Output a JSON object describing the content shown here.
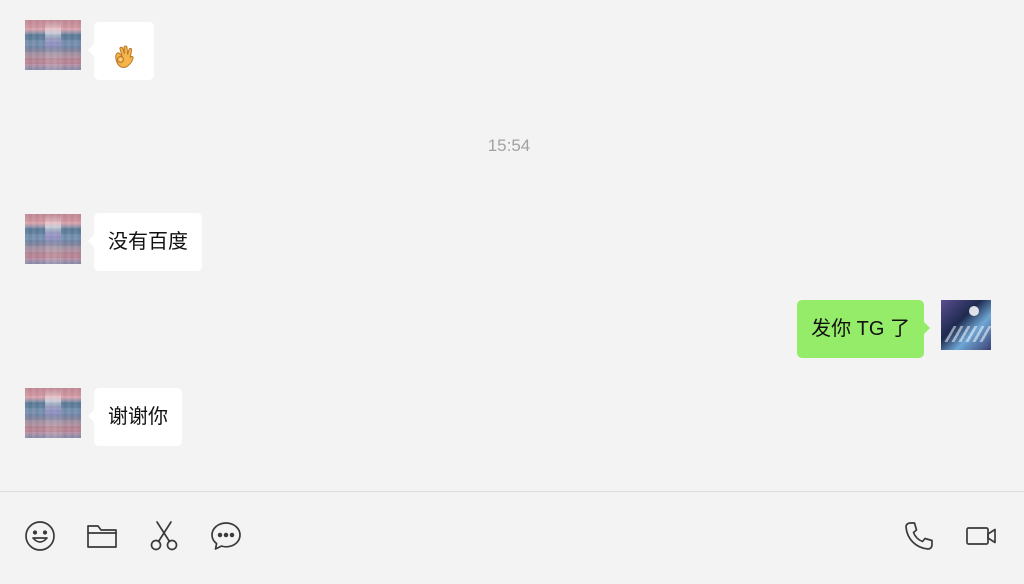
{
  "chat": {
    "messages": [
      {
        "side": "incoming",
        "type": "emoji",
        "icon": "ok-hand-emoji",
        "text": ""
      },
      {
        "side": "system",
        "type": "timestamp",
        "text": "15:54"
      },
      {
        "side": "incoming",
        "type": "text",
        "text": "没有百度"
      },
      {
        "side": "outgoing",
        "type": "text",
        "text": "发你 TG 了"
      },
      {
        "side": "incoming",
        "type": "text",
        "text": "谢谢你"
      }
    ],
    "bubble_colors": {
      "incoming": "#ffffff",
      "outgoing": "#95ec69"
    }
  },
  "toolbar": {
    "left_icons": [
      "smiley-icon",
      "folder-icon",
      "scissors-icon",
      "chat-bubble-icon"
    ],
    "right_icons": [
      "phone-icon",
      "video-camera-icon"
    ]
  }
}
